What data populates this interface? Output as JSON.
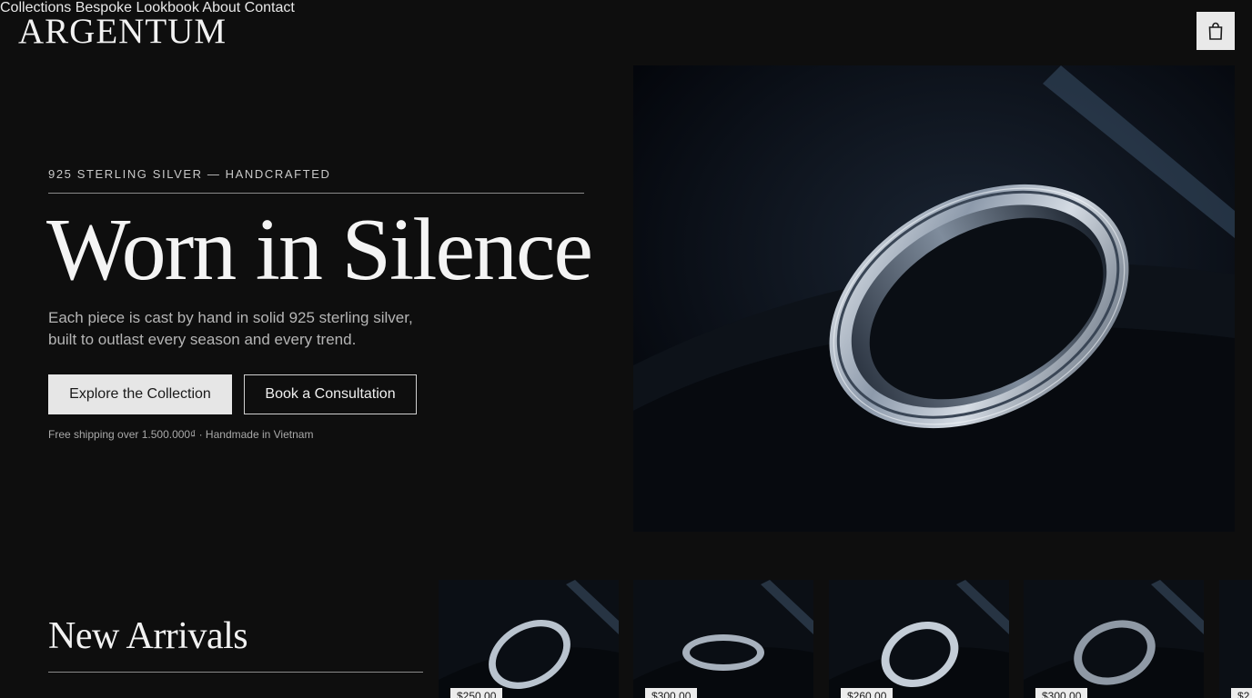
{
  "brand": {
    "name": "ARGENTUM"
  },
  "nav": {
    "items": [
      "Collections",
      "Bespoke",
      "Lookbook",
      "About",
      "Contact"
    ]
  },
  "cart": {
    "icon": "shopping-bag-icon"
  },
  "hero": {
    "eyebrow": "925 STERLING SILVER — HANDCRAFTED",
    "title": "Worn in Silence",
    "subtitle": "Each piece is cast by hand in solid 925 sterling silver, built to outlast every season and every trend.",
    "cta_primary": "Explore the Collection",
    "cta_secondary": "Book a Consultation",
    "note": "Free shipping over 1.500.000₫ · Handmade in Vietnam"
  },
  "new_arrivals": {
    "title": "New Arrivals",
    "products": [
      {
        "price": "$250.00"
      },
      {
        "price": "$300.00"
      },
      {
        "price": "$260.00"
      },
      {
        "price": "$300.00"
      },
      {
        "price": "$2"
      }
    ]
  },
  "colors": {
    "background": "#0e0e0e",
    "text": "#f2f2f2",
    "button": "#e6e6e6"
  }
}
